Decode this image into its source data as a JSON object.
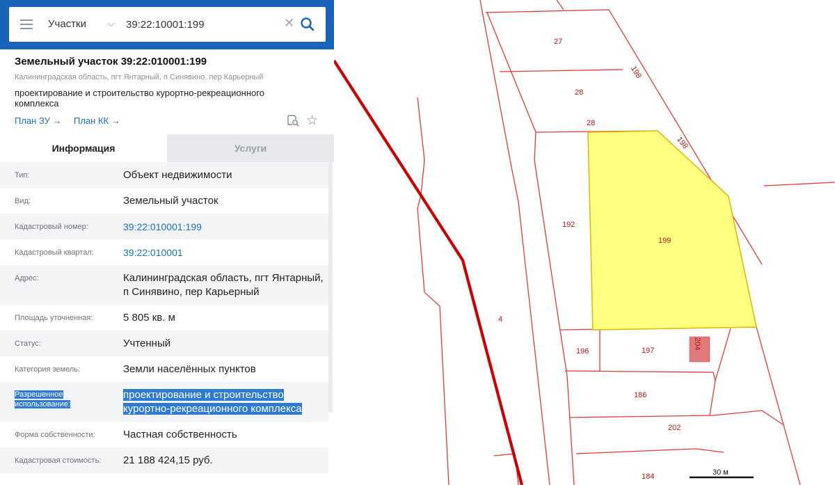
{
  "search": {
    "type_label": "Участки",
    "value": "39:22:10001:199"
  },
  "object": {
    "title": "Земельный участок 39:22:010001:199",
    "address": "Калининградская область, пгт Янтарный, п Синявино, пер Карьерный",
    "purpose": "проектирование и строительство курортно-рекреационного комплекса",
    "plan_zu": "План ЗУ →",
    "plan_kk": "План КК →"
  },
  "tabs": [
    {
      "label": "Информация"
    },
    {
      "label": "Услуги"
    }
  ],
  "properties": [
    {
      "label": "Тип:",
      "value": "Объект недвижимости"
    },
    {
      "label": "Вид:",
      "value": "Земельный участок"
    },
    {
      "label": "Кадастровый номер:",
      "value": "39:22:010001:199"
    },
    {
      "label": "Кадастровый квартал:",
      "value": "39:22:010001"
    },
    {
      "label": "Адрес:",
      "value": "Калининградская область, пгт Янтарный, п Синявино, пер Карьерный"
    },
    {
      "label": "Площадь уточненная:",
      "value": "5 805 кв. м"
    },
    {
      "label": "Статус:",
      "value": "Учтенный"
    },
    {
      "label": "Категория земель:",
      "value": "Земли населённых пунктов"
    },
    {
      "label": "Разрешенное использование:",
      "value": "проектирование и строительство курортно-рекреационного комплекса"
    },
    {
      "label": "Форма собственности:",
      "value": "Частная собственность"
    },
    {
      "label": "Кадастровая стоимость:",
      "value": "21 188 424,15 руб."
    }
  ],
  "map": {
    "parcels": [
      "27",
      "28",
      "28",
      "198",
      "198",
      "192",
      "199",
      "4",
      "196",
      "197",
      "204",
      "186",
      "202",
      "184"
    ],
    "scale_label": "30 м",
    "colors": {
      "boundary": "#e53935",
      "selected_fill": "#ffff80",
      "selected_stroke": "#e0b400",
      "building_fill": "#e07a7a",
      "road": "#cc0000",
      "panel_header": "#1764b8",
      "link": "#1a6fc4",
      "selection": "#2e7bd6"
    }
  },
  "icons": {
    "menu": "hamburger-icon",
    "dropdown": "chevron-down-icon",
    "clear": "close-icon",
    "search": "search-icon",
    "collapse": "chevron-left-icon",
    "preview": "document-search-icon",
    "favorite": "star-icon"
  }
}
